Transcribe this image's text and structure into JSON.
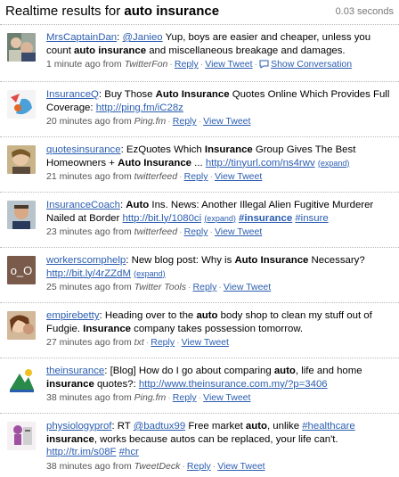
{
  "header": {
    "title_prefix": "Realtime results for ",
    "query": "auto insurance",
    "timing": "0.03 seconds"
  },
  "common": {
    "ago_suffix": " from ",
    "reply": "Reply",
    "view_tweet": "View Tweet",
    "show_conversation": "Show Conversation",
    "expand": "(expand)"
  },
  "tweets": [
    {
      "user": "MrsCaptainDan",
      "t1": ": ",
      "mention": "@Janieo",
      "t2": " Yup, boys are easier and cheaper, unless you count ",
      "b1": "auto insurance",
      "t3": " and miscellaneous breakage and damages.",
      "ago": "1 minute ago",
      "source": "TwitterFon"
    },
    {
      "user": "InsuranceQ",
      "t1": ": Buy Those ",
      "b1": "Auto Insurance",
      "t2": " Quotes Online Which Provides Full Coverage: ",
      "link": "http://ping.fm/iC28z",
      "ago": "20 minutes ago",
      "source": "Ping.fm"
    },
    {
      "user": "quotesinsurance",
      "t1": ": EzQuotes Which ",
      "b1": "Insurance",
      "t2": " Group Gives The Best Homeowners + ",
      "b2": "Auto Insurance",
      "t3": " ... ",
      "link": "http://tinyurl.com/ns4rwv",
      "ago": "21 minutes ago",
      "source": "twitterfeed"
    },
    {
      "user": "InsuranceCoach",
      "t1": ": ",
      "b1": "Auto",
      "t2": " Ins. News: Another Illegal Alien Fugitive Murderer Nailed at Border ",
      "link": "http://bit.ly/1080ci",
      "tag1": "#insurance",
      "tag2": "#insure",
      "ago": "23 minutes ago",
      "source": "twitterfeed"
    },
    {
      "user": "workerscomphelp",
      "t1": ": New blog post: Why is ",
      "b1": "Auto Insurance",
      "t2": " Necessary? ",
      "link": "http://bit.ly/4rZZdM",
      "ago": "25 minutes ago",
      "source": "Twitter Tools"
    },
    {
      "user": "empirebetty",
      "t1": ": Heading over to the ",
      "b1": "auto",
      "t2": " body shop to clean my stuff out of Fudgie. ",
      "b2": "Insurance",
      "t3": " company takes possession tomorrow.",
      "ago": "27 minutes ago",
      "source": "txt"
    },
    {
      "user": "theinsurance",
      "t1": ": [Blog] How do I go about comparing ",
      "b1": "auto",
      "t2": ", life and home ",
      "b2": "insurance",
      "t3": " quotes?: ",
      "link": "http://www.theinsurance.com.my/?p=3406",
      "ago": "38 minutes ago",
      "source": "Ping.fm"
    },
    {
      "user": "physiologyprof",
      "t1": ": RT ",
      "mention": "@badtux99",
      "t2": " Free market ",
      "b1": "auto",
      "t3": ", unlike ",
      "tag1": "#healthcare",
      "t4": " ",
      "b2": "insurance",
      "t5": ", works because autos can be replaced, your life can't. ",
      "link": "http://tr.im/s08F",
      "tag2": "#hcr",
      "ago": "38 minutes ago",
      "source": "TweetDeck"
    }
  ],
  "colors": {
    "link": "#2a5db0",
    "meta": "#555555",
    "divider": "#bbbbbb"
  }
}
